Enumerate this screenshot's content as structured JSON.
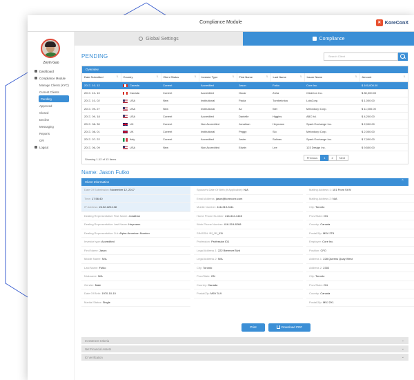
{
  "window": {
    "title": "Compliance Module",
    "brand": "KoreConX"
  },
  "sidebar": {
    "username": "Zeyin Gao",
    "items": [
      {
        "label": "Dashboard",
        "icon": "home-icon",
        "sub": false,
        "active": false
      },
      {
        "label": "Compliance Module",
        "icon": "shield-icon",
        "sub": false,
        "active": false
      },
      {
        "label": "Manage Clients (KYC)",
        "sub": true,
        "active": false
      },
      {
        "label": "Current Clients",
        "sub": true,
        "active": false
      },
      {
        "label": "Pending",
        "sub": true,
        "active": true
      },
      {
        "label": "Approved",
        "sub": true,
        "active": false
      },
      {
        "label": "Closed",
        "sub": true,
        "active": false
      },
      {
        "label": "Decline",
        "sub": true,
        "active": false
      },
      {
        "label": "Messaging",
        "sub": true,
        "active": false
      },
      {
        "label": "Reports",
        "sub": true,
        "active": false
      },
      {
        "label": "OFI",
        "sub": true,
        "active": false
      },
      {
        "label": "Logout",
        "icon": "logout-icon",
        "sub": false,
        "active": false
      }
    ]
  },
  "tabs": {
    "global": "Global Settings",
    "compliance": "Compliance"
  },
  "pending": {
    "title": "PENDING",
    "search_placeholder": "Search Client",
    "panel_title": "Overview",
    "columns": [
      "Date Submitted",
      "Country",
      "Client Status",
      "Investor Type",
      "First Name",
      "Last Name",
      "Issuer Name",
      "Amount"
    ],
    "rows": [
      {
        "date": "2017- 10- 12",
        "flag": "CA",
        "country": "Canada",
        "status": "Current",
        "type": "Accredited",
        "first": "Jason",
        "last": "Futko",
        "issuer": "Core Inc.",
        "amount": "$ 100,000.00",
        "selected": true
      },
      {
        "date": "2017- 10- 10",
        "flag": "CA",
        "country": "Canada",
        "status": "Current",
        "type": "Accredited",
        "first": "Oscar",
        "last": "Zoha",
        "issuer": "ClickCon Inc.",
        "amount": "$ 80,000.00",
        "selected": false
      },
      {
        "date": "2017- 10- 02",
        "flag": "US",
        "country": "USA",
        "status": "New",
        "type": "Institutional",
        "first": "Paula",
        "last": "Turnbeknica",
        "issuer": "LolaCorp.",
        "amount": "$ 1,000.00",
        "selected": false
      },
      {
        "date": "2017- 09- 27",
        "flag": "US",
        "country": "USA",
        "status": "New",
        "type": "Institutional",
        "first": "Ax",
        "last": "Wei",
        "issuer": "Melonkorp Corp.",
        "amount": "$ 11,000.00",
        "selected": false
      },
      {
        "date": "2017- 09- 18",
        "flag": "US",
        "country": "USA",
        "status": "Current",
        "type": "Accredited",
        "first": "Danielle",
        "last": "Higgins",
        "issuer": "ABC ltd.",
        "amount": "$ 4,200.00",
        "selected": false
      },
      {
        "date": "2017- 08- 30",
        "flag": "UK",
        "country": "UK",
        "status": "Current",
        "type": "Non Accredited",
        "first": "Jonathan",
        "last": "Heymann",
        "issuer": "Spark Exchange Inc.",
        "amount": "$ 2,000.00",
        "selected": false
      },
      {
        "date": "2017- 08- 01",
        "flag": "UK",
        "country": "UK",
        "status": "Current",
        "type": "Institutional",
        "first": "Peggy",
        "last": "Sio",
        "issuer": "Melonkorp Corp.",
        "amount": "$ 2,000.00",
        "selected": false
      },
      {
        "date": "2017- 07- 22",
        "flag": "IT",
        "country": "Italy",
        "status": "Current",
        "type": "Accredited",
        "first": "Javier",
        "last": "Salinas",
        "issuer": "Spark Exchange Inc.",
        "amount": "$ 7,000.00",
        "selected": false
      },
      {
        "date": "2017- 06- 09",
        "flag": "US",
        "country": "USA",
        "status": "New",
        "type": "Non Accredited",
        "first": "Edwin",
        "last": "Lee",
        "issuer": "123 Design Inc.",
        "amount": "$ 9,500.00",
        "selected": false
      }
    ],
    "showing": "Showing 1-12 of 13 Items",
    "pager": {
      "prev": "Previous",
      "pages": [
        "1",
        "2"
      ],
      "current": "1",
      "next": "Next"
    }
  },
  "client": {
    "name_title": "Name: Jason Futko",
    "info_title": "Client Information",
    "columns": [
      [
        {
          "label": "Date Of Submission:",
          "value": "November 12, 2017",
          "hl": true
        },
        {
          "label": "Time:",
          "value": "17:56:40",
          "hl": true
        },
        {
          "label": "IP Address:",
          "value": "24.52.220.138",
          "hl": true
        },
        {
          "label": "Dealing Representative First Name:",
          "value": "Jonathan",
          "hl": false
        },
        {
          "label": "Dealing Representative Last Name:",
          "value": "Heymann",
          "hl": false
        },
        {
          "label": "Dealing Representative O.#:",
          "value": "Alpha-American Number",
          "hl": false
        },
        {
          "label": "Investor type:",
          "value": "Accredited",
          "hl": false
        },
        {
          "label": "First Name:",
          "value": "Jason",
          "hl": false
        },
        {
          "label": "Middle Name:",
          "value": "N/A",
          "hl": false
        },
        {
          "label": "Last Name:",
          "value": "Futko",
          "hl": false
        },
        {
          "label": "Nickname:",
          "value": "N/A",
          "hl": false
        },
        {
          "label": "Gender:",
          "value": "Male",
          "hl": false
        },
        {
          "label": "Date Of Birth:",
          "value": "1970-10-10",
          "hl": false
        },
        {
          "label": "Marital Status:",
          "value": "Single",
          "hl": false
        }
      ],
      [
        {
          "label": "Spouse's Date Of Birth (If Applicable):",
          "value": "N/A"
        },
        {
          "label": "Email Address:",
          "value": "jason@koreconx.com"
        },
        {
          "label": "Mobile Number:",
          "value": "416-319-3111"
        },
        {
          "label": "Home Phone Number:",
          "value": "416-312-1445"
        },
        {
          "label": "Work Phone Number:",
          "value": "416-319-8268"
        },
        {
          "label": "SIN/SSN:",
          "value": "***_***_111"
        },
        {
          "label": "Profession:",
          "value": "Profession ID1"
        },
        {
          "label": "Legal Address 1:",
          "value": "222 Bremner Blvd"
        },
        {
          "label": "Legal Address 2:",
          "value": "N/A"
        },
        {
          "label": "City:",
          "value": "Toronto"
        },
        {
          "label": "Prov/State:",
          "value": "ON"
        },
        {
          "label": "Country:",
          "value": "Canada"
        },
        {
          "label": "Postal/Zip:",
          "value": "M5V 3L9"
        }
      ],
      [
        {
          "label": "Mailing Address 1:",
          "value": "101 Front St W"
        },
        {
          "label": "Mailing Address 2:",
          "value": "N/A"
        },
        {
          "label": "City:",
          "value": "Toronto"
        },
        {
          "label": "Prov/State:",
          "value": "ON"
        },
        {
          "label": "Country:",
          "value": "Canada"
        },
        {
          "label": "Postal/Zip:",
          "value": "M5V 2T6"
        },
        {
          "label": "Employer:",
          "value": "Core Inc."
        },
        {
          "label": "Position:",
          "value": "CFO"
        },
        {
          "label": "Address 1:",
          "value": "228 Queens Quay West"
        },
        {
          "label": "Address 2:",
          "value": "2302"
        },
        {
          "label": "City:",
          "value": "Toronto"
        },
        {
          "label": "Prov/State:",
          "value": "ON"
        },
        {
          "label": "Country:",
          "value": "Canada"
        },
        {
          "label": "Postal/Zip:",
          "value": "M5J 2X1"
        }
      ]
    ],
    "print_label": "Print",
    "pdf_label": "Download PDF"
  },
  "accordions": [
    "Investment Criteria",
    "Net Financial Assets",
    "ID Verification"
  ]
}
